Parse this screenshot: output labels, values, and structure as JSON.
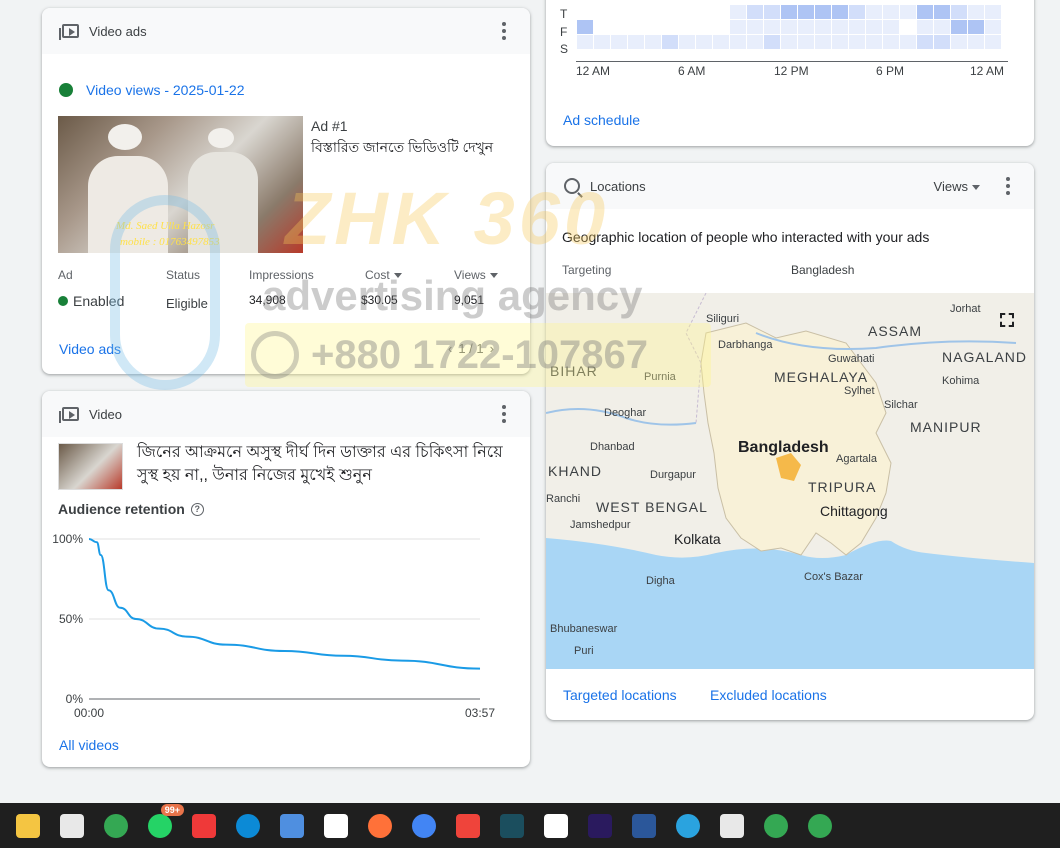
{
  "video_ads_card": {
    "title": "Video ads",
    "campaign_link": "Video views - 2025-01-22",
    "ad_number": "Ad #1",
    "ad_headline": "বিস্তারিত জানতে ভিডিওটি দেখুন",
    "thumb_caption_1": "Md. Saed Ulla Hazosr",
    "thumb_caption_2": "mobile : 01763497853",
    "columns": [
      "Ad",
      "Status",
      "Impressions",
      "Cost",
      "Views"
    ],
    "row": {
      "ad": "Enabled",
      "status": "Eligible",
      "impressions": "34,908",
      "cost": "$30.05",
      "views": "9,051"
    },
    "footer_link": "Video ads",
    "pager": "1 / 1"
  },
  "video_card": {
    "title": "Video",
    "video_title": "জিনের আক্রমনে অসুস্থ দীর্ঘ দিন ডাক্তার এর চিকিৎসা নিয়ে সুস্থ হয় না,, উনার নিজের মুখেই শুনুন",
    "retention_label": "Audience retention",
    "footer_link": "All videos"
  },
  "chart_data": {
    "type": "line",
    "title": "Audience retention",
    "x_start_label": "00:00",
    "x_end_label": "03:57",
    "y_ticks": [
      "100%",
      "50%",
      "0%"
    ],
    "ylim": [
      0,
      100
    ],
    "x": [
      0,
      0.02,
      0.03,
      0.05,
      0.08,
      0.12,
      0.18,
      0.25,
      0.35,
      0.5,
      0.65,
      0.8,
      1.0
    ],
    "values": [
      100,
      98,
      90,
      68,
      57,
      50,
      44,
      39,
      34,
      30,
      27,
      24,
      19
    ],
    "grid": true
  },
  "schedule_card": {
    "row_labels": [
      "T",
      "F",
      "S"
    ],
    "x_labels": [
      "12 AM",
      "6 AM",
      "12 PM",
      "6 PM",
      "12 AM"
    ],
    "link": "Ad schedule",
    "heat": [
      [
        0,
        0,
        0,
        0,
        0,
        0,
        0,
        0,
        0,
        1,
        2,
        2,
        3,
        3,
        3,
        3,
        2,
        1,
        1,
        1,
        3,
        3,
        2,
        1,
        1
      ],
      [
        3,
        0,
        0,
        0,
        0,
        0,
        0,
        0,
        0,
        1,
        1,
        1,
        1,
        1,
        1,
        1,
        1,
        1,
        1,
        0,
        1,
        1,
        3,
        3,
        1
      ],
      [
        1,
        1,
        1,
        1,
        1,
        2,
        1,
        1,
        1,
        1,
        1,
        2,
        1,
        1,
        1,
        1,
        1,
        1,
        1,
        1,
        2,
        2,
        1,
        1,
        1
      ]
    ],
    "heat_colors": [
      "#ffffff",
      "#e8eefc",
      "#d2defa",
      "#aec4f4"
    ]
  },
  "locations_card": {
    "title": "Locations",
    "metric": "Views",
    "subtitle": "Geographic location of people who interacted with your ads",
    "targeting_label": "Targeting",
    "targeting_value": "Bangladesh",
    "map_labels": [
      {
        "text": "Siliguri",
        "cls": "small"
      },
      {
        "text": "ASSAM",
        "cls": "caps"
      },
      {
        "text": "Jorhat",
        "cls": "small"
      },
      {
        "text": "NAGALAND",
        "cls": "caps"
      },
      {
        "text": "Darbhanga",
        "cls": "small"
      },
      {
        "text": "Guwahati",
        "cls": "small"
      },
      {
        "text": "MEGHALAYA",
        "cls": "caps"
      },
      {
        "text": "BIHAR",
        "cls": "caps"
      },
      {
        "text": "Purnia",
        "cls": "small"
      },
      {
        "text": "Kohima",
        "cls": "small"
      },
      {
        "text": "Sylhet",
        "cls": "small"
      },
      {
        "text": "Silchar",
        "cls": "small"
      },
      {
        "text": "Deoghar",
        "cls": "small"
      },
      {
        "text": "MANIPUR",
        "cls": "caps"
      },
      {
        "text": "Dhanbad",
        "cls": "small"
      },
      {
        "text": "Bangladesh",
        "cls": "big"
      },
      {
        "text": "KHAND",
        "cls": "caps"
      },
      {
        "text": "Agartala",
        "cls": "small"
      },
      {
        "text": "Durgapur",
        "cls": "small"
      },
      {
        "text": "TRIPURA",
        "cls": "caps"
      },
      {
        "text": "Ranchi",
        "cls": "small"
      },
      {
        "text": "WEST BENGAL",
        "cls": "caps"
      },
      {
        "text": "Chittagong",
        "cls": "mid"
      },
      {
        "text": "Jamshedpur",
        "cls": "small"
      },
      {
        "text": "Kolkata",
        "cls": "mid"
      },
      {
        "text": "Cox's Bazar",
        "cls": "small"
      },
      {
        "text": "Digha",
        "cls": "small"
      },
      {
        "text": "Bhubaneswar",
        "cls": "small"
      },
      {
        "text": "Puri",
        "cls": "small"
      }
    ],
    "links": [
      "Targeted locations",
      "Excluded locations"
    ]
  },
  "watermark": {
    "brand": "ZHK 360",
    "tagline": "advertising agency",
    "phone": "+880 1722-107867"
  },
  "taskbar": {
    "icons": [
      "file-explorer-icon",
      "snipping-tool-icon",
      "chrome-icon",
      "whatsapp-icon",
      "vivaldi-icon",
      "edge-icon",
      "store-icon",
      "capcut-icon",
      "firefox-icon",
      "sync-icon",
      "anydesk-icon",
      "filmora-icon",
      "capcut-2-icon",
      "premiere-icon",
      "word-icon",
      "telegram-icon",
      "app-icon",
      "chrome-2-icon",
      "chrome-3-icon"
    ],
    "whatsapp_badge": "99+"
  }
}
